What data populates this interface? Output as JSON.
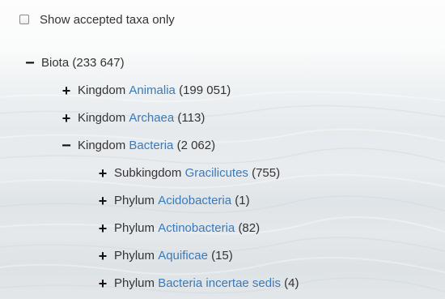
{
  "filter": {
    "label": "Show accepted taxa only",
    "checked": false
  },
  "tree": {
    "root": {
      "toggle": "−",
      "name": "Biota",
      "count": "(233 647)"
    },
    "kingdoms": [
      {
        "toggle": "+",
        "rank": "Kingdom",
        "name": "Animalia",
        "count": "(199 051)"
      },
      {
        "toggle": "+",
        "rank": "Kingdom",
        "name": "Archaea",
        "count": "(113)"
      },
      {
        "toggle": "−",
        "rank": "Kingdom",
        "name": "Bacteria",
        "count": "(2 062)"
      }
    ],
    "bacteria_children": [
      {
        "toggle": "+",
        "rank": "Subkingdom",
        "name": "Gracilicutes",
        "count": "(755)"
      },
      {
        "toggle": "+",
        "rank": "Phylum",
        "name": "Acidobacteria",
        "count": "(1)"
      },
      {
        "toggle": "+",
        "rank": "Phylum",
        "name": "Actinobacteria",
        "count": "(82)"
      },
      {
        "toggle": "+",
        "rank": "Phylum",
        "name": "Aquificae",
        "count": "(15)"
      },
      {
        "toggle": "+",
        "rank": "Phylum",
        "name": "Bacteria incertae sedis",
        "count": "(4)"
      }
    ]
  },
  "colors": {
    "link": "#3a7ab8",
    "text": "#333333",
    "toggle": "#111111"
  }
}
